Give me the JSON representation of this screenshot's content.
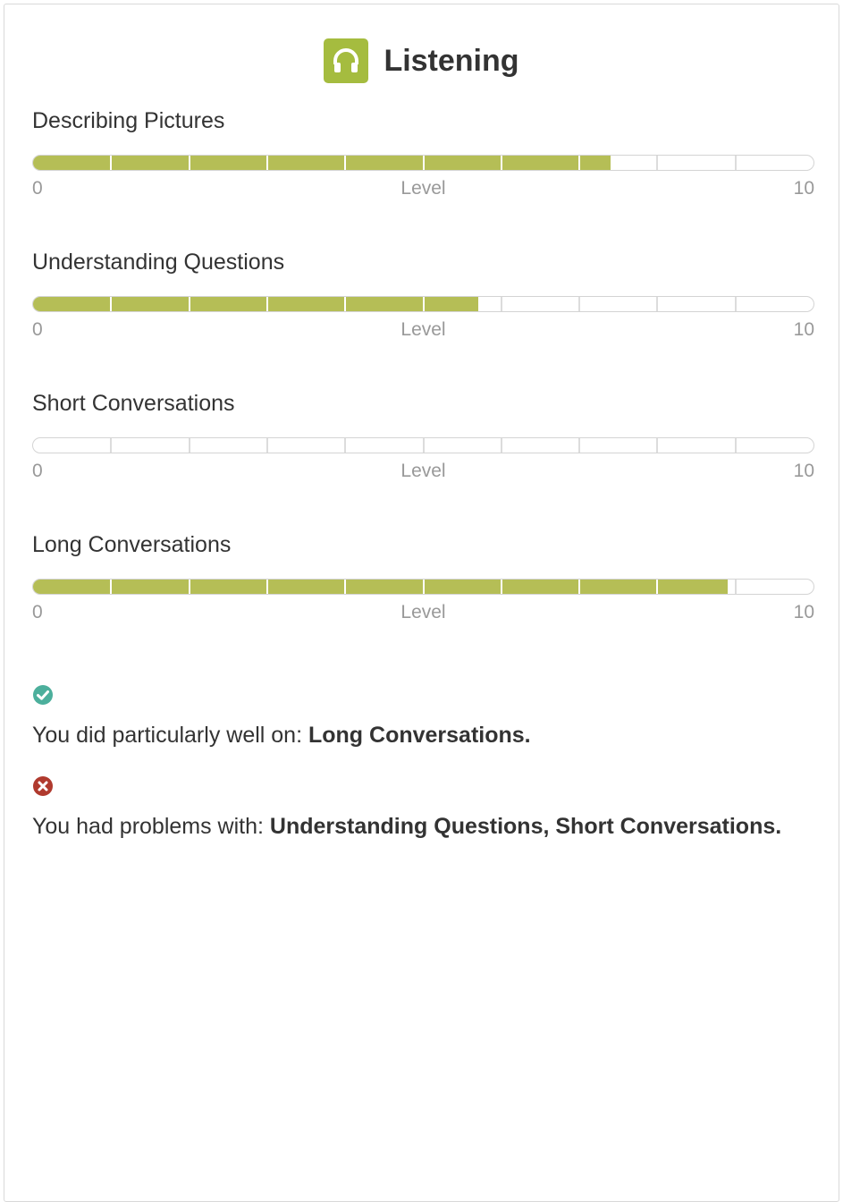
{
  "header": {
    "title": "Listening",
    "icon": "headphones-icon",
    "icon_color": "#a5bc3f"
  },
  "scale": {
    "min_label": "0",
    "mid_label": "Level",
    "max_label": "10",
    "max": 10
  },
  "colors": {
    "fill": "#b5be56",
    "success": "#4caf9c",
    "error": "#b03a2e"
  },
  "skills": [
    {
      "name": "Describing Pictures",
      "level": 7.4
    },
    {
      "name": "Understanding Questions",
      "level": 5.7
    },
    {
      "name": "Short Conversations",
      "level": 0
    },
    {
      "name": "Long Conversations",
      "level": 8.9
    }
  ],
  "feedback": {
    "good": {
      "icon": "check-circle-icon",
      "prefix": "You did particularly well on: ",
      "items": "Long Conversations."
    },
    "bad": {
      "icon": "x-circle-icon",
      "prefix": "You had problems with: ",
      "items": "Understanding Questions, Short Conversations."
    }
  }
}
